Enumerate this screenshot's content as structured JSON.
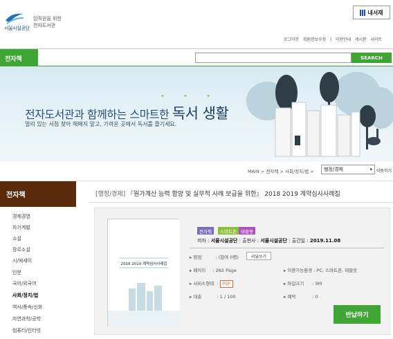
{
  "header": {
    "logo_text": "서울시설공단",
    "logo_sub_1": "임직원을 위한",
    "logo_sub_2": "전자도서관",
    "mylib_icon": "bars-icon",
    "mylib_label": "내서재",
    "links": [
      "로그아웃",
      "회원정보수정",
      "|",
      "이용안내",
      "게시판",
      "사이트"
    ]
  },
  "nav": {
    "title": "전자책",
    "search_placeholder": "",
    "search_button": "SEARCH"
  },
  "banner": {
    "title_prefix": "전자도서관과 함께하는 스마트한",
    "title_emph": "독서 생활",
    "dots": "• • •",
    "subtitle": "멀리 있는 서점 찾아 헤매지 말고, 가까운 곳에서 독서를 즐기세요."
  },
  "crumb": {
    "path": "MAIN > 전자책 > 사회/정치/법 >",
    "select_value": "행정/경제",
    "move_label": "이동하기"
  },
  "sidebar": {
    "title": "전자책",
    "items": [
      "경제경영",
      "자기계발",
      "소설",
      "장르소설",
      "시/에세이",
      "인문",
      "국어/외국어",
      "사회/정치/법",
      "역사/풍속/신화",
      "자연과학/공학",
      "컴퓨터/인터넷"
    ],
    "active_index": 7
  },
  "book": {
    "category": "[행정/경제]",
    "title": "『원가계산 능력 함양 및 실무적 사례 보급을 위한』 2018 2019 계약심사사례집",
    "badges": [
      {
        "label": "전자책",
        "color": "#7b6bb8"
      },
      {
        "label": "스마트폰",
        "color": "#8bbf3c"
      },
      {
        "label": "태블릿",
        "color": "#b04fc0"
      }
    ],
    "author_label": "저자",
    "author": "서울시설공단",
    "publisher_label": "출판사",
    "publisher": "서울시설공단",
    "date_label": "출간일",
    "date": "2019.11.08",
    "rating_label": "평점",
    "rating_value": ": (참여 0명)",
    "review_button": "리뷰쓰기",
    "pages_label": "페이지",
    "pages_value": ": 282 Page",
    "devices_label": "이용가능환경",
    "devices_value": ": PC, 스마트폰, 태블릿",
    "format_label": "서비스형태",
    "format_value": "PDF",
    "filesize_label": "파일크기",
    "filesize_value": ": 9M",
    "loan_label": "대출",
    "loan_value": ": 1 / 100",
    "reserve_label": "예약",
    "reserve_value": ": 0",
    "return_button": "반납하기",
    "cover_title": "2018 2019 계약심사사례집"
  }
}
